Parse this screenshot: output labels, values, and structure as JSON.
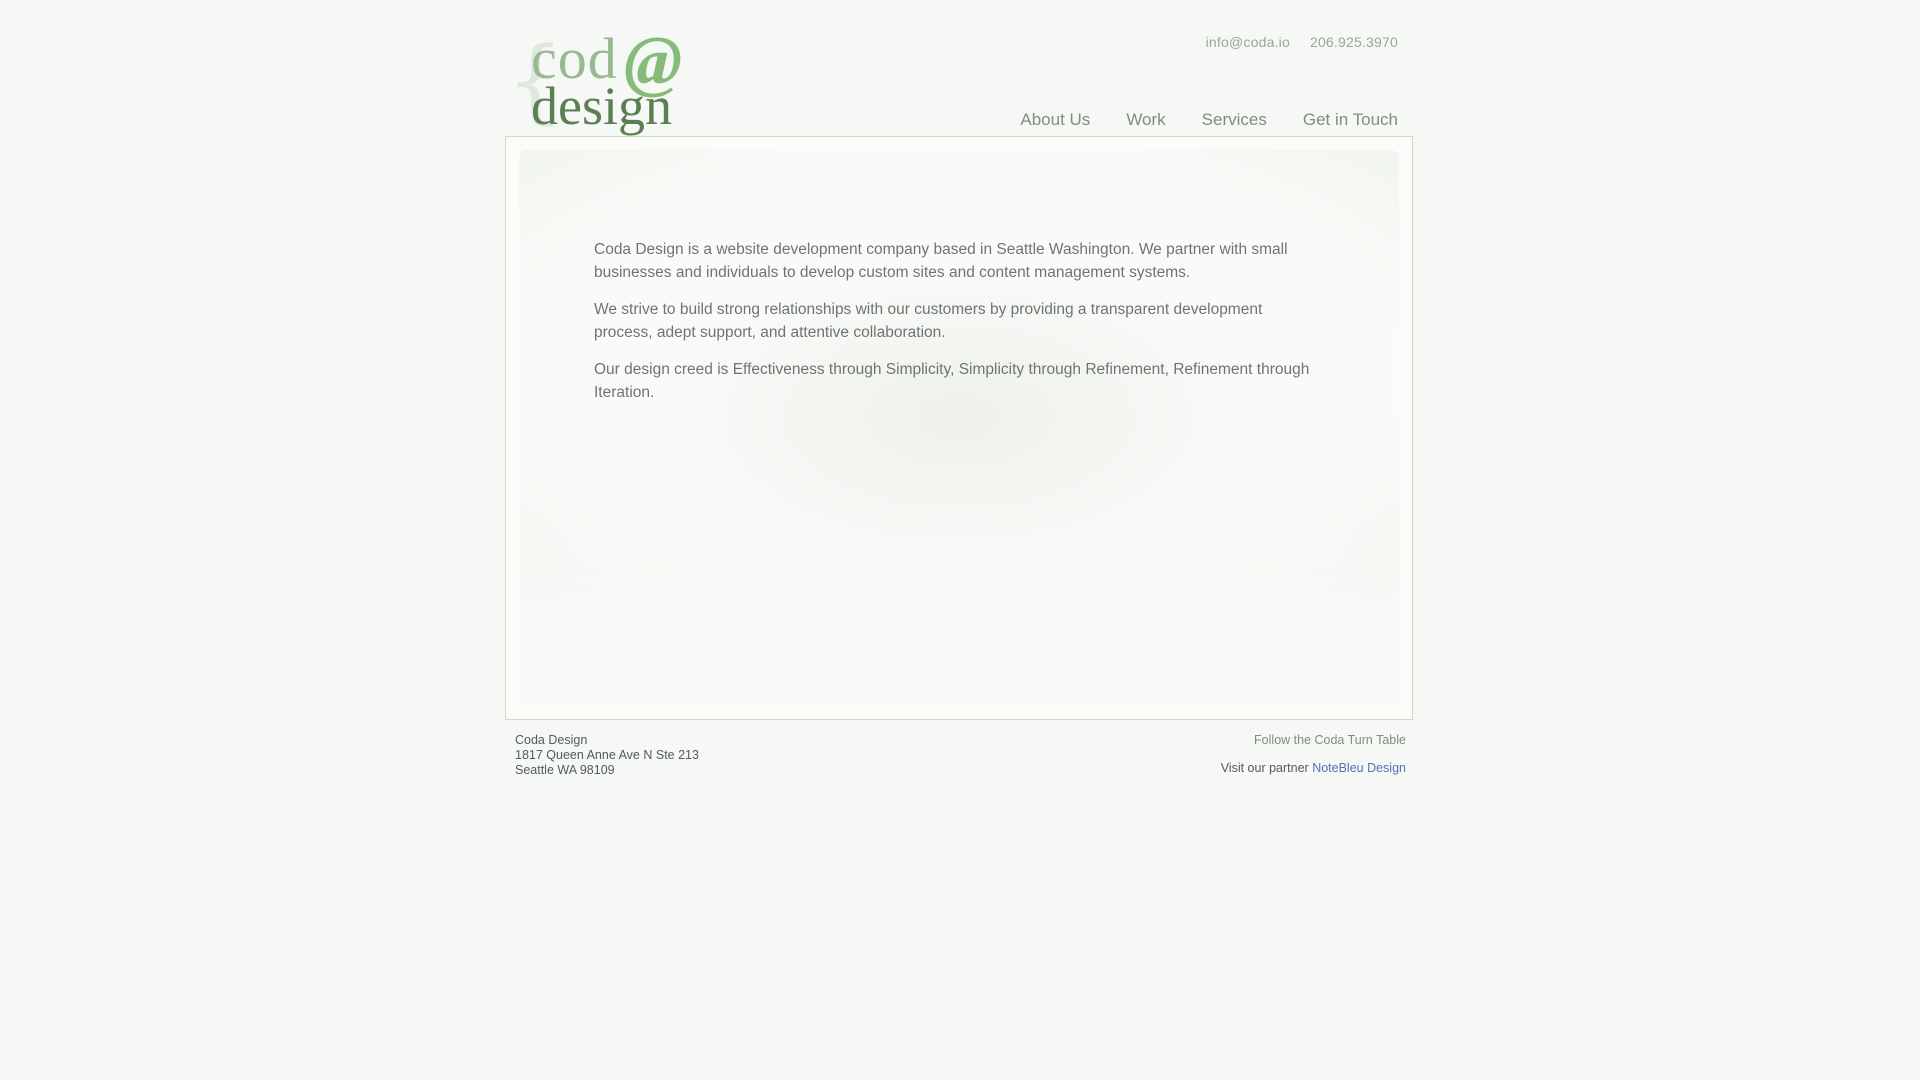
{
  "header": {
    "logo": {
      "brace": "{",
      "word_top": "cod",
      "at_symbol": "@",
      "word_bottom": "design"
    },
    "contact": {
      "email": "info@coda.io",
      "phone": "206.925.3970"
    },
    "nav": [
      {
        "label": "About Us"
      },
      {
        "label": "Work"
      },
      {
        "label": "Services"
      },
      {
        "label": "Get in Touch"
      }
    ]
  },
  "main": {
    "paragraphs": [
      "Coda Design is a website development company based in Seattle Washington. We partner with small businesses and individuals to develop custom sites and content management systems.",
      "We strive to build strong relationships with our customers by providing a transparent development process, adept support, and attentive collaboration.",
      "Our design creed is Effectiveness through Simplicity, Simplicity through Refinement, Refinement through Iteration."
    ]
  },
  "footer": {
    "company": "Coda Design",
    "address_line1": "1817 Queen Anne Ave N Ste 213",
    "address_line2": "Seattle WA 98109",
    "turntable_link": "Follow the Coda Turn Table",
    "partner_prefix": "Visit our partner",
    "partner_link": "NoteBleu Design"
  },
  "colors": {
    "background": "#f5f8f4",
    "logo_green_dark": "#5f8a55",
    "logo_green_light": "#8fbd80",
    "nav_text": "#7f8e7f",
    "body_text": "#6d7570",
    "link_blue": "#5a6fb5"
  }
}
